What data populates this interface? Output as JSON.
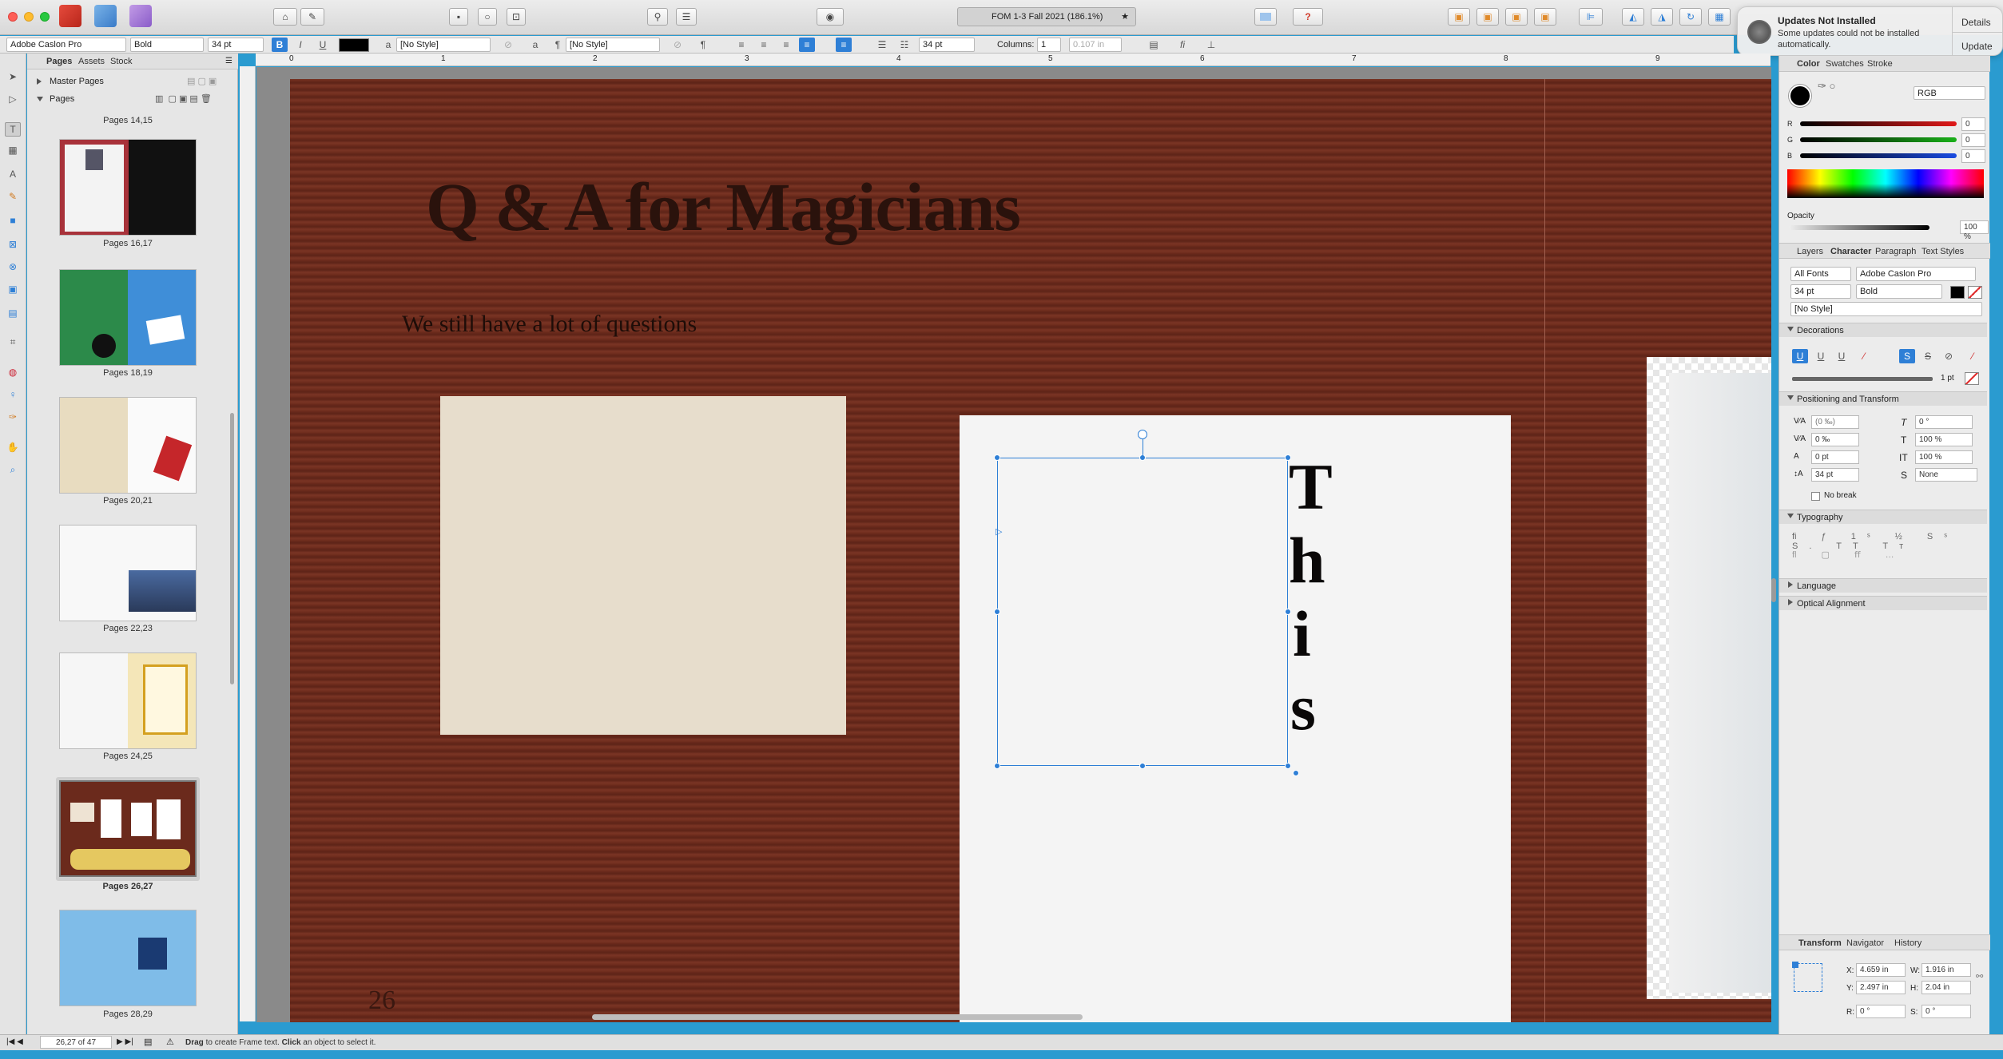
{
  "window": {
    "doc_title": "FOM 1-3 Fall 2021 (186.1%)"
  },
  "notification": {
    "title": "Updates Not Installed",
    "body_line1": "Some updates could not be installed",
    "body_line2": "automatically.",
    "details_label": "Details",
    "update_label": "Update"
  },
  "context_toolbar": {
    "font_family": "Adobe Caslon Pro",
    "font_style": "Bold",
    "font_size": "34 pt",
    "char_style": "[No Style]",
    "para_style": "[No Style]",
    "leading": "34 pt",
    "columns_label": "Columns:",
    "columns_value": "1",
    "gutter": "0.107 in"
  },
  "ruler": {
    "ticks": [
      "0",
      "1",
      "2",
      "3",
      "4",
      "5",
      "6",
      "7",
      "8",
      "9"
    ]
  },
  "pages_panel": {
    "tabs": [
      "Pages",
      "Assets",
      "Stock"
    ],
    "master_pages_label": "Master Pages",
    "pages_label": "Pages",
    "top_label": "Pages 14,15",
    "items": [
      {
        "label": "Pages 16,17"
      },
      {
        "label": "Pages 18,19"
      },
      {
        "label": "Pages 20,21"
      },
      {
        "label": "Pages 22,23"
      },
      {
        "label": "Pages 24,25"
      },
      {
        "label": "Pages 26,27"
      },
      {
        "label": "Pages 28,29"
      }
    ]
  },
  "canvas": {
    "headline": "Q & A for Magicians",
    "subhead": "We still have a lot of questions",
    "frame_text": [
      "T",
      "h",
      "i",
      "s"
    ],
    "page_number": "26"
  },
  "color_panel": {
    "tabs": [
      "Color",
      "Swatches",
      "Stroke"
    ],
    "model": "RGB",
    "channels": [
      {
        "name": "R",
        "value": "0"
      },
      {
        "name": "G",
        "value": "0"
      },
      {
        "name": "B",
        "value": "0"
      }
    ],
    "opacity_label": "Opacity",
    "opacity_value": "100 %"
  },
  "character_panel": {
    "tabs": [
      "Layers",
      "Character",
      "Paragraph",
      "Text Styles"
    ],
    "font_collection": "All Fonts",
    "font_family": "Adobe Caslon Pro",
    "font_size": "34 pt",
    "font_style": "Bold",
    "style": "[No Style]",
    "decorations_label": "Decorations",
    "stroke_weight": "1 pt",
    "positioning_label": "Positioning and Transform",
    "kerning": "(0 ‰)",
    "tracking": "0 ‰",
    "baseline": "0 pt",
    "leading": "34 pt",
    "skew": "0 °",
    "vscale": "100 %",
    "hscale": "100 %",
    "baseline_grid": "None",
    "no_break_label": "No break",
    "typography_label": "Typography",
    "language_label": "Language",
    "optical_label": "Optical Alignment"
  },
  "transform_panel": {
    "tabs": [
      "Transform",
      "Navigator",
      "History"
    ],
    "x": "4.659 in",
    "y": "2.497 in",
    "w": "1.916 in",
    "h": "2.04 in",
    "r": "0 °",
    "s": "0 °"
  },
  "status_bar": {
    "page_indicator": "26,27 of 47",
    "hint_drag": "Drag",
    "hint_mid": " to create Frame text. ",
    "hint_click": "Click",
    "hint_end": " an object to select it."
  },
  "colors": {
    "accent": "#2e7fd6",
    "wood": "#6b2a1c",
    "panel_bg": "#ececec"
  }
}
